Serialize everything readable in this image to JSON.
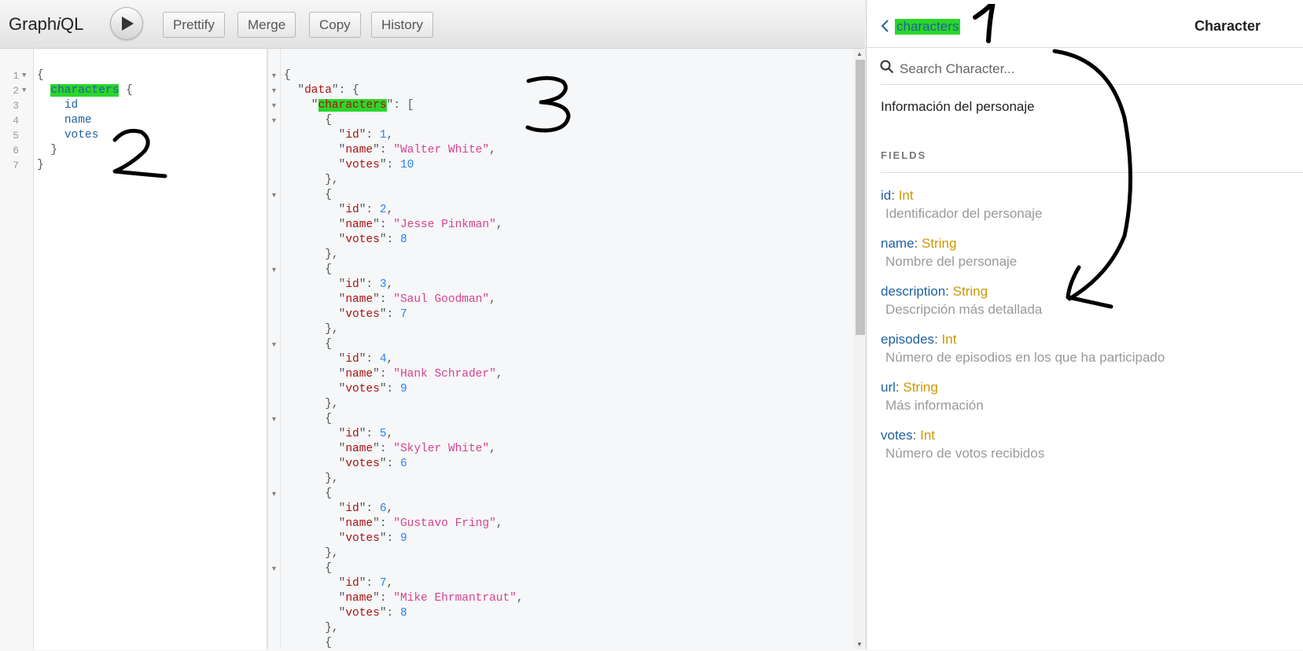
{
  "toolbar": {
    "logo_prefix": "Graph",
    "logo_italic": "i",
    "logo_suffix": "QL",
    "buttons": [
      "Prettify",
      "Merge",
      "Copy",
      "History"
    ]
  },
  "query": {
    "line_numbers": [
      "1",
      "2",
      "3",
      "4",
      "5",
      "6",
      "7"
    ],
    "open_brace": "{",
    "root_field": "characters",
    "root_brace": " {",
    "fields": [
      "id",
      "name",
      "votes"
    ],
    "inner_close": "}",
    "outer_close": "}"
  },
  "result": {
    "data_key": "data",
    "list_key": "characters",
    "items": [
      {
        "id": 1,
        "name": "Walter White",
        "votes": 10
      },
      {
        "id": 2,
        "name": "Jesse Pinkman",
        "votes": 8
      },
      {
        "id": 3,
        "name": "Saul Goodman",
        "votes": 7
      },
      {
        "id": 4,
        "name": "Hank Schrader",
        "votes": 9
      },
      {
        "id": 5,
        "name": "Skyler White",
        "votes": 6
      },
      {
        "id": 6,
        "name": "Gustavo Fring",
        "votes": 9
      },
      {
        "id": 7,
        "name": "Mike Ehrmantraut",
        "votes": 8
      }
    ]
  },
  "docs": {
    "back_label": "characters",
    "title": "Character",
    "search_placeholder": "Search Character...",
    "description": "Información del personaje",
    "fields_heading": "FIELDS",
    "fields": [
      {
        "name": "id",
        "type": "Int",
        "description": "Identificador del personaje"
      },
      {
        "name": "name",
        "type": "String",
        "description": "Nombre del personaje"
      },
      {
        "name": "description",
        "type": "String",
        "description": "Descripción más detallada"
      },
      {
        "name": "episodes",
        "type": "Int",
        "description": "Número de episodios en los que ha participado"
      },
      {
        "name": "url",
        "type": "String",
        "description": "Más información"
      },
      {
        "name": "votes",
        "type": "Int",
        "description": "Número de votos recibidos"
      }
    ]
  },
  "annotations": [
    "1",
    "2",
    "3"
  ],
  "colors": {
    "highlight": "#2bd52b",
    "field_blue": "#1f61a0",
    "type_gold": "#ca9800",
    "string_pink": "#d64292",
    "number_blue": "#2882f9",
    "key_red": "#a11"
  }
}
